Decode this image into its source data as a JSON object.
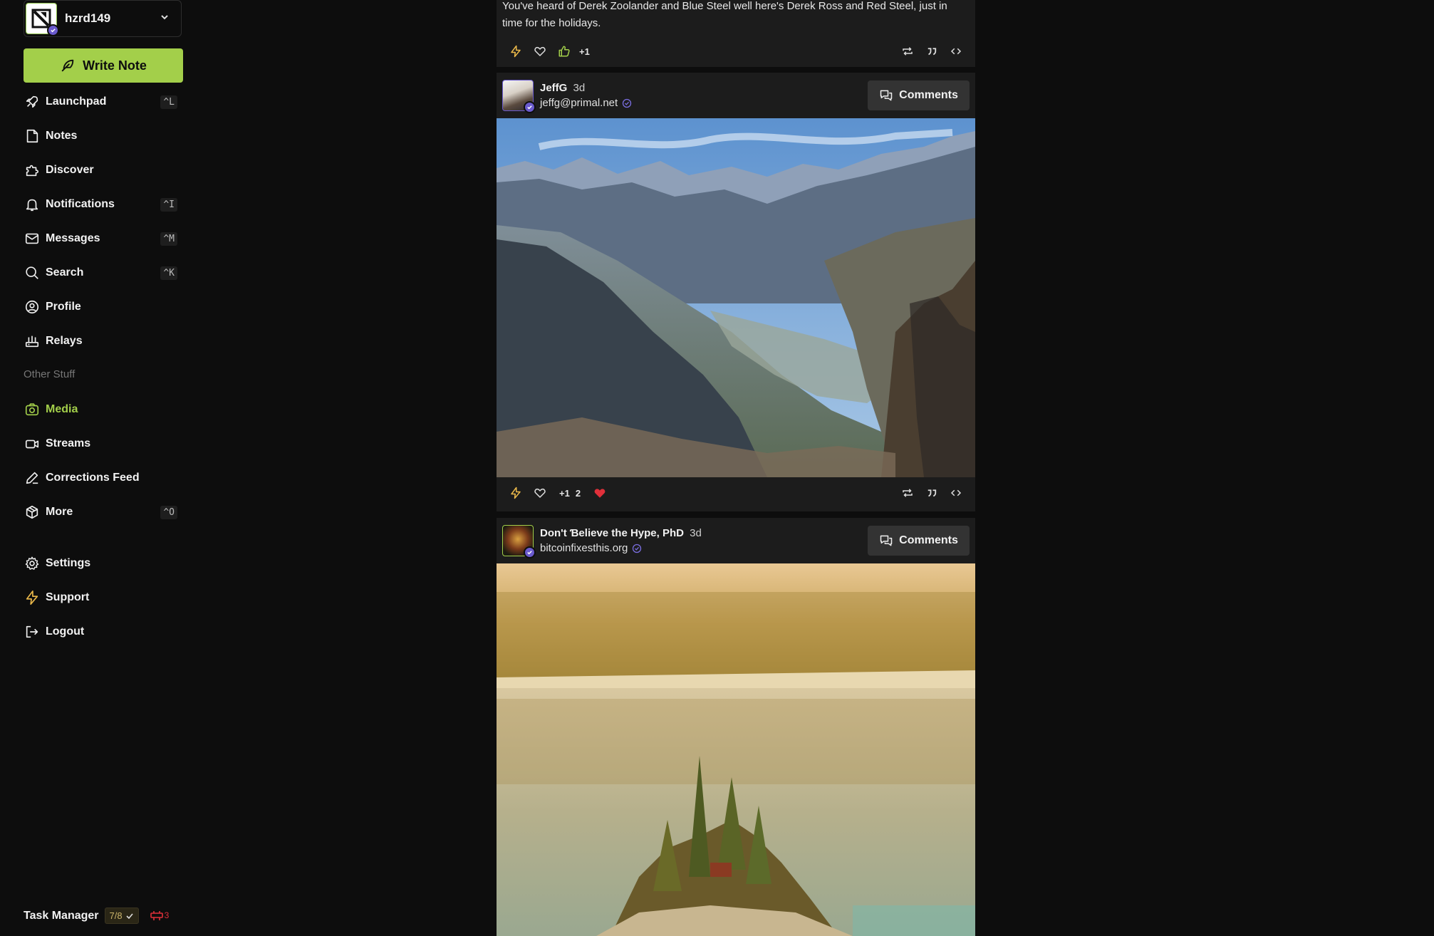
{
  "account": {
    "username": "hzrd149"
  },
  "sidebar": {
    "write_note": "Write Note",
    "items": [
      {
        "label": "Launchpad",
        "shortcut": "^L"
      },
      {
        "label": "Notes",
        "shortcut": ""
      },
      {
        "label": "Discover",
        "shortcut": ""
      },
      {
        "label": "Notifications",
        "shortcut": "^I"
      },
      {
        "label": "Messages",
        "shortcut": "^M"
      },
      {
        "label": "Search",
        "shortcut": "^K"
      },
      {
        "label": "Profile",
        "shortcut": ""
      },
      {
        "label": "Relays",
        "shortcut": ""
      }
    ],
    "other_label": "Other Stuff",
    "other_items": [
      {
        "label": "Media",
        "shortcut": "",
        "active": true
      },
      {
        "label": "Streams",
        "shortcut": ""
      },
      {
        "label": "Corrections Feed",
        "shortcut": ""
      },
      {
        "label": "More",
        "shortcut": "^O"
      }
    ],
    "bottom_items": [
      {
        "label": "Settings"
      },
      {
        "label": "Support"
      },
      {
        "label": "Logout"
      }
    ],
    "task_manager": {
      "label": "Task Manager",
      "progress": "7/8",
      "alerts": "3"
    }
  },
  "colors": {
    "accent": "#a3cf4a",
    "verified": "#6a5acd",
    "like": "#e0303a"
  },
  "feed": {
    "post0": {
      "text": "You've heard of Derek Zoolander and Blue Steel well here's Derek Ross and Red Steel, just in time for the holidays.",
      "reaction_count": "+1"
    },
    "post1": {
      "author": "JeffG",
      "age": "3d",
      "nip05": "jeffg@primal.net",
      "comments_label": "Comments",
      "reaction_label": "+1",
      "reaction_count": "2"
    },
    "post2": {
      "author": "Don't Ɓelieve the Hype, PhD",
      "age": "3d",
      "nip05": "bitcoinfixesthis.org",
      "comments_label": "Comments"
    }
  }
}
